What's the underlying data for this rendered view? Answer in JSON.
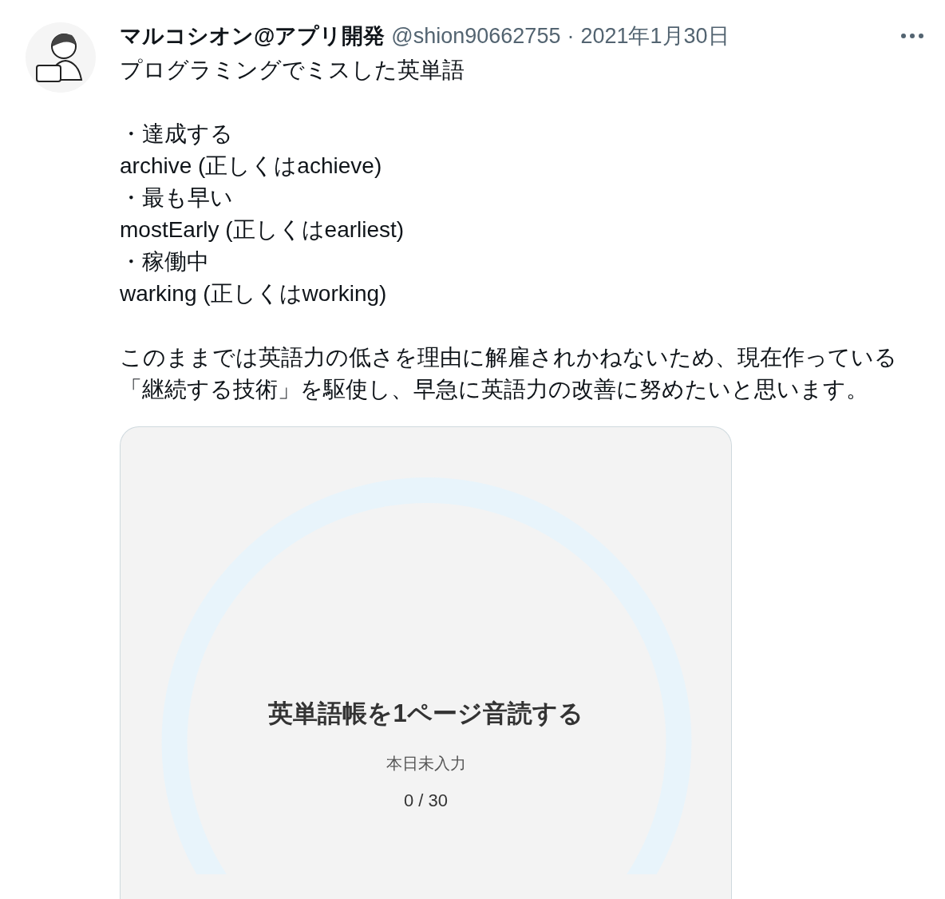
{
  "tweet": {
    "author": {
      "name": "マルコシオン@アプリ開発",
      "handle": "@shion90662755"
    },
    "separator": "·",
    "date": "2021年1月30日",
    "paragraphs": [
      [
        "プログラミングでミスした英単語"
      ],
      [
        "・達成する",
        "archive (正しくはachieve)",
        "・最も早い",
        "mostEarly (正しくはearliest)",
        "・稼働中",
        "warking (正しくはworking)"
      ],
      [
        "このままでは英語力の低さを理由に解雇されかねないため、現在作っている「継続する技術」を駆使し、早急に英語力の改善に努めたいと思います。"
      ]
    ],
    "card": {
      "title": "英単語帳を1ページ音読する",
      "status": "本日未入力",
      "reading": "0 / 30"
    }
  }
}
